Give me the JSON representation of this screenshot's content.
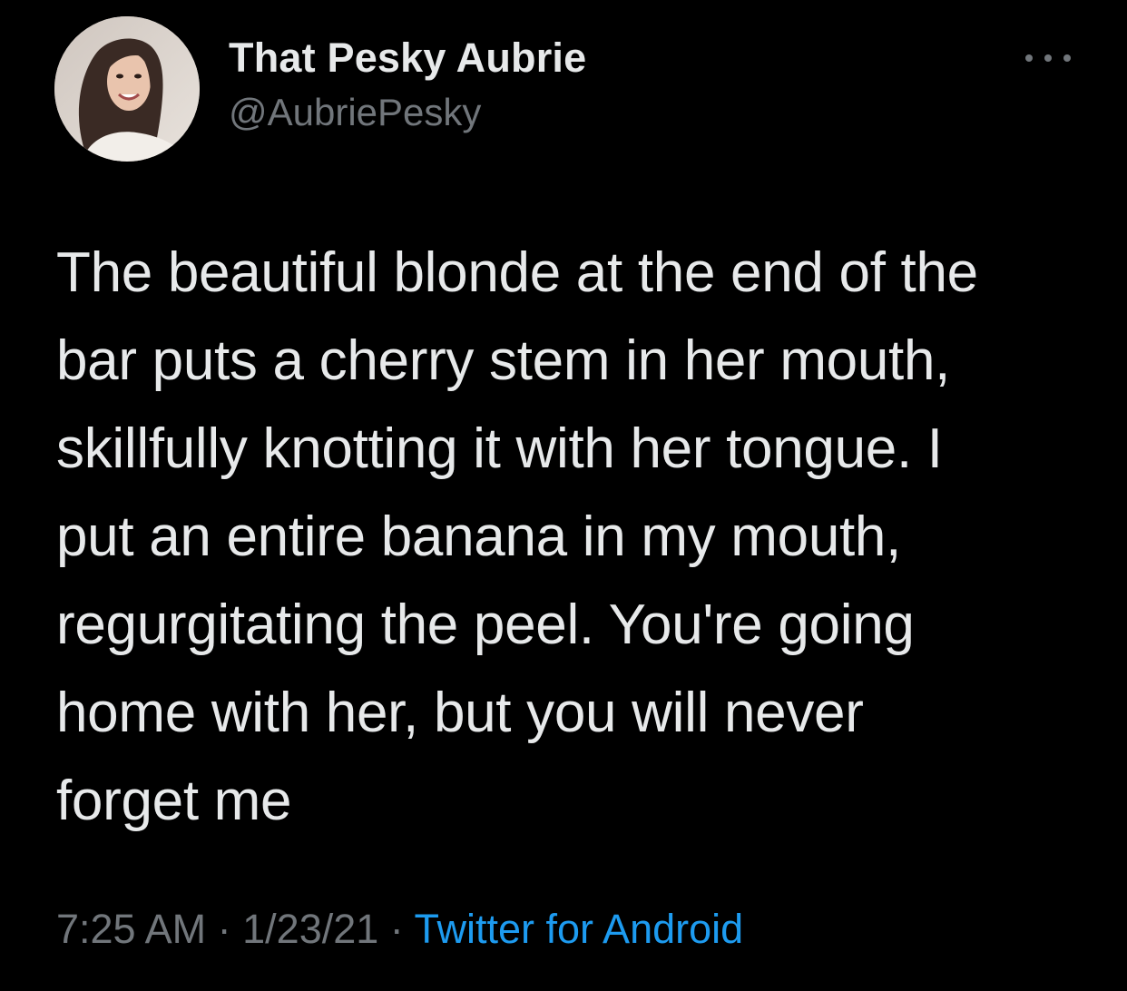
{
  "tweet": {
    "author": {
      "display_name": "That Pesky Aubrie",
      "handle": "@AubriePesky",
      "avatar_icon": "profile-photo"
    },
    "text": "The beautiful blonde at the end of the\nbar puts a cherry stem in her mouth,\nskillfully knotting it with her tongue. I\nput an entire banana in my mouth,\nregurgitating the peel. You're going\nhome with her, but you will never\nforget me",
    "time": "7:25 AM",
    "separator": "·",
    "date": "1/23/21",
    "source": "Twitter for Android",
    "more_icon": "more-horizontal-icon"
  },
  "colors": {
    "background": "#000000",
    "text_primary": "#e7e9ea",
    "text_secondary": "#71767b",
    "link": "#1d9bf0"
  }
}
